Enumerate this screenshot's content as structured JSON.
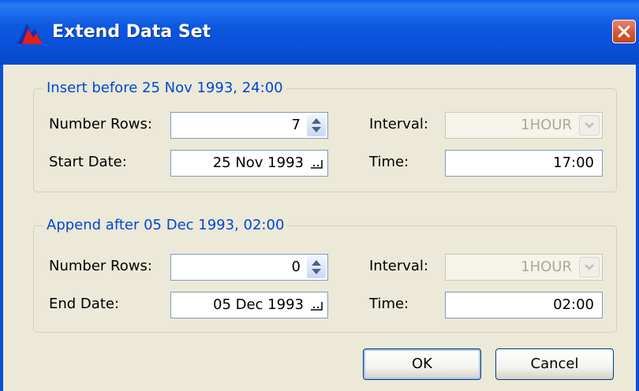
{
  "window": {
    "title": "Extend Data Set",
    "icon": "app-mountain-icon",
    "close_icon": "close-icon"
  },
  "insert_group": {
    "legend": "Insert before 25 Nov 1993, 24:00",
    "rows_label": "Number Rows:",
    "rows_value": "7",
    "start_label": "Start Date:",
    "start_value": "25 Nov 1993",
    "interval_label": "Interval:",
    "interval_value": "1HOUR",
    "time_label": "Time:",
    "time_value": "17:00"
  },
  "append_group": {
    "legend": "Append after 05 Dec 1993, 02:00",
    "rows_label": "Number Rows:",
    "rows_value": "0",
    "end_label": "End Date:",
    "end_value": "05 Dec 1993",
    "interval_label": "Interval:",
    "interval_value": "1HOUR",
    "time_label": "Time:",
    "time_value": "02:00"
  },
  "buttons": {
    "ok": "OK",
    "cancel": "Cancel"
  },
  "colors": {
    "titlebar": "#0A50D8",
    "dialog_bg": "#ECE9D8",
    "legend_text": "#0046D5",
    "close_button": "#D75630"
  }
}
